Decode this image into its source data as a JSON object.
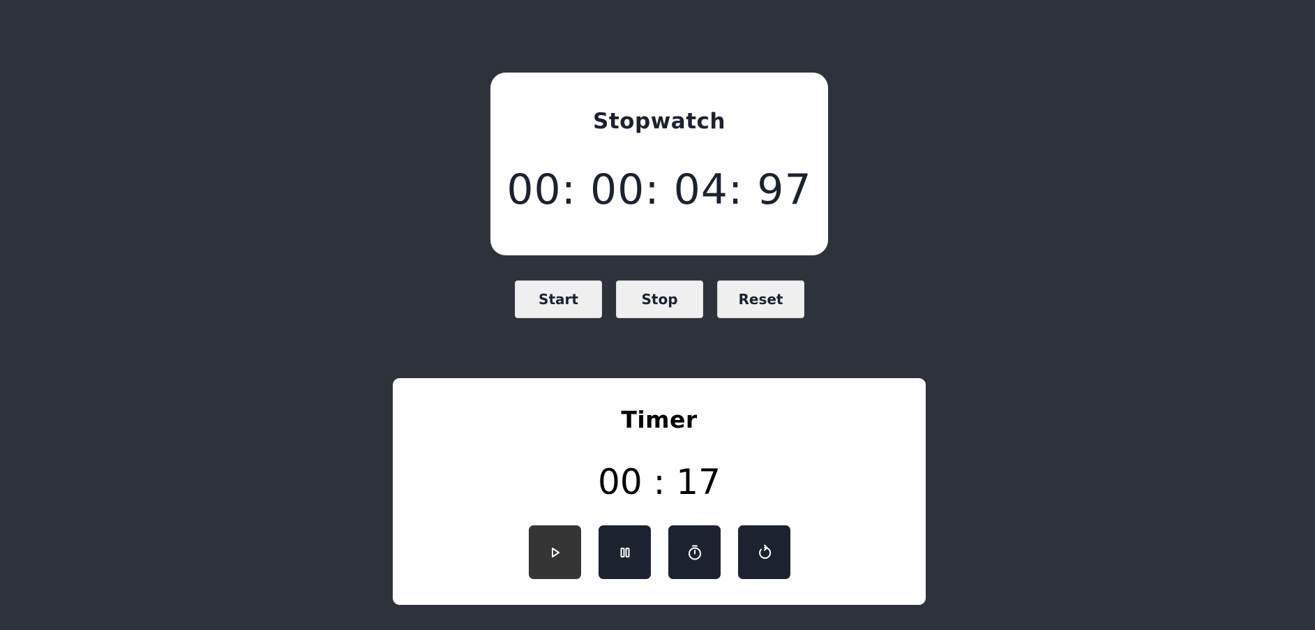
{
  "stopwatch": {
    "title": "Stopwatch",
    "time": "00: 00: 04: 97",
    "buttons": {
      "start": "Start",
      "stop": "Stop",
      "reset": "Reset"
    }
  },
  "timer": {
    "title": "Timer",
    "time": "00 : 17",
    "controls": [
      {
        "icon": "play-icon"
      },
      {
        "icon": "pause-icon"
      },
      {
        "icon": "stopwatch-icon"
      },
      {
        "icon": "reset-icon"
      }
    ]
  },
  "colors": {
    "background": "#2e333b",
    "card": "#ffffff",
    "text_dark": "#1c2230",
    "control_button": "#1c2230",
    "control_button_active": "#353535",
    "secondary_button": "#efefef"
  }
}
